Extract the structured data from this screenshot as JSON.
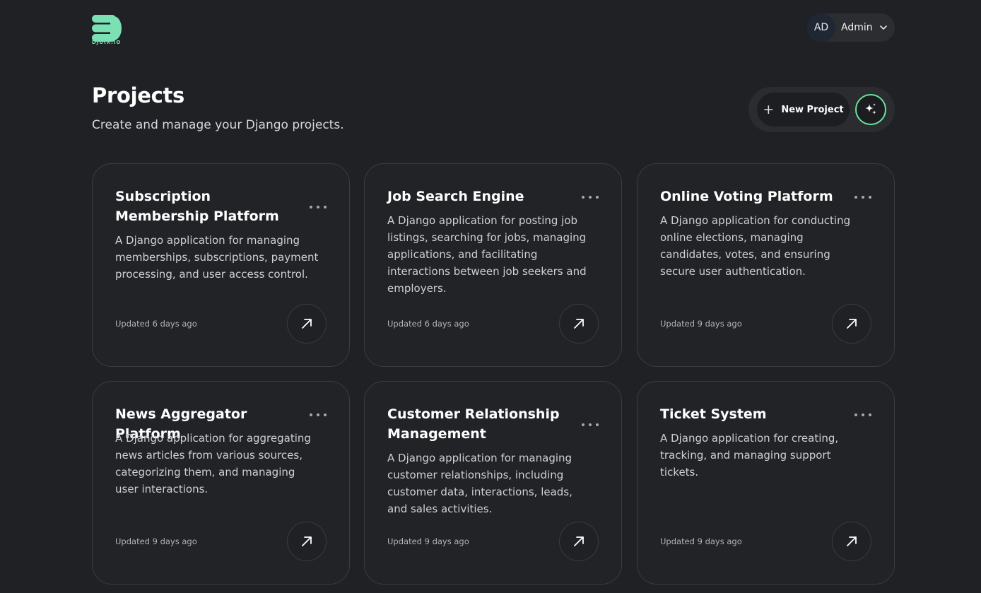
{
  "header": {
    "logo_text": "DJUIX.IO",
    "user": {
      "initials": "AD",
      "name": "Admin"
    }
  },
  "page": {
    "title": "Projects",
    "subtitle": "Create and manage your Django projects.",
    "new_project_label": "New Project"
  },
  "colors": {
    "background": "#202124",
    "card": "#222327",
    "accent_green": "#6be19d",
    "logo_green": "#7be0b4"
  },
  "projects": [
    {
      "title": "Subscription Membership Platform",
      "description": "A Django application for managing memberships, subscriptions, payment processing, and user access control.",
      "updated": "Updated 6 days ago"
    },
    {
      "title": "Job Search Engine",
      "description": "A Django application for posting job listings, searching for jobs, managing applications, and facilitating interactions between job seekers and employers.",
      "updated": "Updated 6 days ago"
    },
    {
      "title": "Online Voting Platform",
      "description": "A Django application for conducting online elections, managing candidates, votes, and ensuring secure user authentication.",
      "updated": "Updated 9 days ago"
    },
    {
      "title": "News Aggregator Platform",
      "description": "A Django application for aggregating news articles from various sources, categorizing them, and managing user interactions.",
      "updated": "Updated 9 days ago"
    },
    {
      "title": "Customer Relationship Management",
      "description": "A Django application for managing customer relationships, including customer data, interactions, leads, and sales activities.",
      "updated": "Updated 9 days ago"
    },
    {
      "title": "Ticket System",
      "description": "A Django application for creating, tracking, and managing support tickets.",
      "updated": "Updated 9 days ago"
    }
  ]
}
